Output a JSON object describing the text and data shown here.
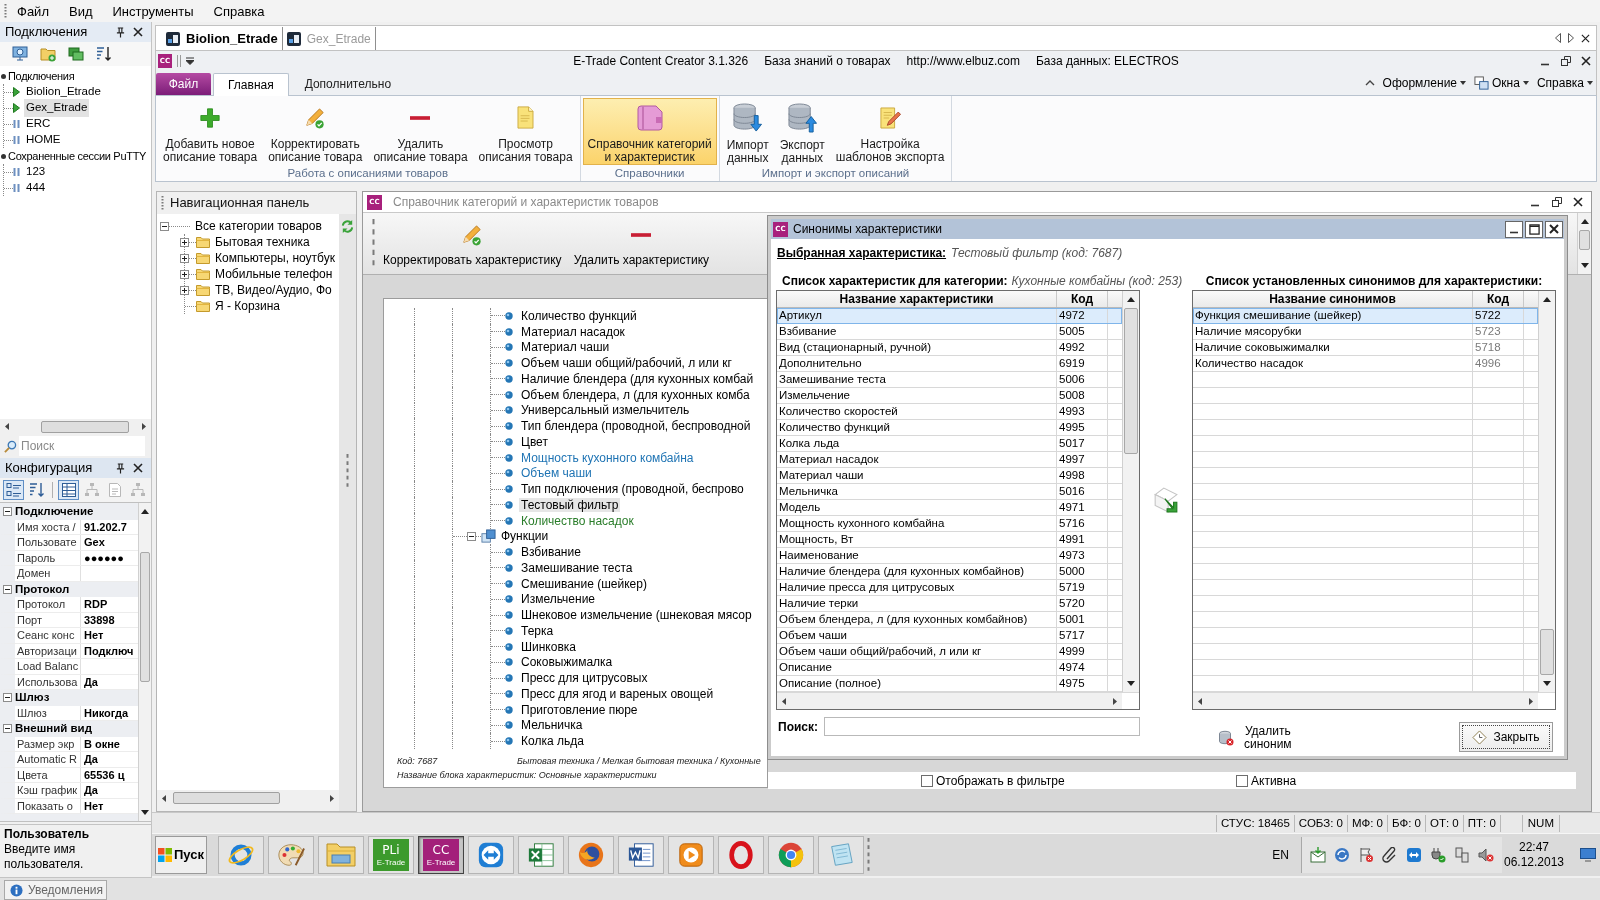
{
  "menu_bar": [
    "Файл",
    "Вид",
    "Инструменты",
    "Справка"
  ],
  "connections_panel": {
    "title": "Подключения",
    "tree": [
      {
        "label": "Подключения",
        "kind": "group",
        "children": [
          {
            "label": "Biolion_Etrade",
            "kind": "connected",
            "selected": false
          },
          {
            "label": "Gex_Etrade",
            "kind": "connected",
            "selected": true
          },
          {
            "label": "ERC",
            "kind": "saved",
            "selected": false
          },
          {
            "label": "HOME",
            "kind": "saved",
            "selected": false
          }
        ]
      },
      {
        "label": "Сохраненные сессии PuTTY",
        "kind": "group",
        "children": [
          {
            "label": "123",
            "kind": "saved",
            "selected": false
          },
          {
            "label": "444",
            "kind": "saved",
            "selected": false
          }
        ]
      }
    ],
    "search": {
      "placeholder": "Поиск"
    }
  },
  "configuration_panel": {
    "title": "Конфигурация",
    "toolbar": [
      {
        "kind": "categorized",
        "selected": true,
        "disabled": false
      },
      {
        "kind": "alphabetical",
        "selected": false,
        "disabled": false
      },
      {
        "kind": "properties",
        "selected": true,
        "disabled": false
      },
      {
        "kind": "hierarchy",
        "selected": false,
        "disabled": true
      },
      {
        "kind": "page",
        "selected": false,
        "disabled": true
      },
      {
        "kind": "hierarchy",
        "selected": false,
        "disabled": true
      }
    ],
    "categories": [
      {
        "name": "Подключение",
        "expanded": true,
        "rows": [
          {
            "label": "Имя хоста /",
            "value": "91.202.7"
          },
          {
            "label": "Пользовате",
            "value": "Gex"
          },
          {
            "label": "Пароль",
            "value": "●●●●●●"
          },
          {
            "label": "Домен"
          }
        ]
      },
      {
        "name": "Протокол",
        "expanded": true,
        "rows": [
          {
            "label": "Протокол",
            "value": "RDP"
          },
          {
            "label": "Порт",
            "value": "33898"
          },
          {
            "label": "Сеанс конс",
            "value": "Нет"
          },
          {
            "label": "Авторизаци",
            "value": "Подключ"
          },
          {
            "label": "Load Balanc"
          },
          {
            "label": "Использова",
            "value": "Да"
          }
        ]
      },
      {
        "name": "Шлюз",
        "expanded": true,
        "rows": [
          {
            "label": "Шлюз",
            "value": "Никогда"
          }
        ]
      },
      {
        "name": "Внешний вид",
        "expanded": true,
        "rows": [
          {
            "label": "Размер экр",
            "value": "В окне"
          },
          {
            "label": "Automatic R",
            "value": "Да"
          },
          {
            "label": "Цвета",
            "value": "65536 ц"
          },
          {
            "label": "Кэш график",
            "value": "Да"
          },
          {
            "label": "Показать о",
            "value": "Нет"
          }
        ]
      }
    ],
    "help": {
      "title": "Пользователь",
      "text": "Введите имя пользователя."
    }
  },
  "document_tabs": [
    {
      "label": "Biolion_Etrade",
      "selected": true
    },
    {
      "label": "Gex_Etrade",
      "selected": false
    }
  ],
  "title_bar": {
    "logo": "CC",
    "app": "E-Trade Content Creator 3.1.326",
    "links": [
      "База знаний о товарах",
      "http://www.elbuz.com"
    ],
    "database": "База данных: ELECTROS"
  },
  "ribbon": {
    "tabs": [
      {
        "label": "Файл",
        "kind": "app",
        "selected": false
      },
      {
        "label": "Главная",
        "kind": "tab",
        "selected": true
      },
      {
        "label": "Дополнительно",
        "kind": "tab",
        "selected": false
      }
    ],
    "menus": [
      {
        "label": "Оформление",
        "kind": "menu"
      },
      {
        "label": "Окна",
        "kind": "windows"
      },
      {
        "label": "Справка",
        "kind": "menu"
      }
    ],
    "groups": [
      {
        "label": "Работа с описаниями товаров",
        "buttons": [
          {
            "label": "Добавить новое\nописание товара",
            "kind": "add",
            "selected": false
          },
          {
            "label": "Корректировать\nописание товара",
            "kind": "edit",
            "selected": false
          },
          {
            "label": "Удалить\nописание товара",
            "kind": "delete",
            "selected": false
          },
          {
            "label": "Просмотр\nописания товара",
            "kind": "view",
            "selected": false
          }
        ]
      },
      {
        "label": "Справочники",
        "buttons": [
          {
            "label": "Справочник категорий\nи характеристик",
            "kind": "catalog",
            "selected": true
          }
        ]
      },
      {
        "label": "Импорт и экспорт описаний",
        "buttons": [
          {
            "label": "Импорт\nданных",
            "kind": "import",
            "selected": false
          },
          {
            "label": "Экспорт\nданных",
            "kind": "export",
            "selected": false
          },
          {
            "label": "Настройка\nшаблонов экспорта",
            "kind": "templates",
            "selected": false
          }
        ]
      }
    ]
  },
  "navigation_panel": {
    "title": "Навигационная панель",
    "tree": [
      {
        "label": "Все категории товаров",
        "expanded": true,
        "children": [
          {
            "label": "Бытовая техника",
            "expanded": false
          },
          {
            "label": "Компьютеры, ноутбук",
            "expanded": false
          },
          {
            "label": "Мобильные телефон",
            "expanded": false
          },
          {
            "label": "ТВ, Видео/Аудио, Фо",
            "expanded": false
          },
          {
            "label": "Я - Корзина"
          }
        ]
      }
    ]
  },
  "document_window": {
    "logo": "CC",
    "title": "Справочник категорий и характеристик товаров",
    "toolbar": [
      {
        "label": "Корректировать характеристику",
        "kind": "edit"
      },
      {
        "label": "Удалить характеристику",
        "kind": "delete"
      }
    ],
    "tree": [
      {
        "label": "Количество функций",
        "kind": "leaf",
        "color": "#000000",
        "selected": false
      },
      {
        "label": "Материал насадок",
        "kind": "leaf",
        "color": "#000000",
        "selected": false
      },
      {
        "label": "Материал чаши",
        "kind": "leaf",
        "color": "#000000",
        "selected": false
      },
      {
        "label": "Объем чаши общий/рабочий, л или кг",
        "kind": "leaf",
        "color": "#000000",
        "selected": false
      },
      {
        "label": "Наличие блендера (для кухонных комбай",
        "kind": "leaf",
        "color": "#000000",
        "selected": false
      },
      {
        "label": "Объем блендера, л (для кухонных комба",
        "kind": "leaf",
        "color": "#000000",
        "selected": false
      },
      {
        "label": "Универсальный измельчитель",
        "kind": "leaf",
        "color": "#000000",
        "selected": false
      },
      {
        "label": "Тип блендера (проводной, беспроводной",
        "kind": "leaf",
        "color": "#000000",
        "selected": false
      },
      {
        "label": "Цвет",
        "kind": "leaf",
        "color": "#000000",
        "selected": false
      },
      {
        "label": "Мощность кухонного комбайна",
        "kind": "leaf",
        "color": "#1f74b4",
        "selected": false
      },
      {
        "label": "Объем чаши",
        "kind": "leaf",
        "color": "#1f74b4",
        "selected": false
      },
      {
        "label": "Тип подключения (проводной, беспрово",
        "kind": "leaf",
        "color": "#000000",
        "selected": false
      },
      {
        "label": "Тестовый фильтр",
        "kind": "leaf",
        "color": "#000000",
        "selected": true
      },
      {
        "label": "Количество насадок",
        "kind": "leaf",
        "color": "#2a7d2a",
        "selected": false
      },
      {
        "label": "Функции",
        "kind": "group",
        "color": "#000000",
        "selected": false,
        "expanded": true,
        "children": [
          {
            "label": "Взбивание",
            "kind": "leaf",
            "color": "#000000",
            "selected": false
          },
          {
            "label": "Замешивание теста",
            "kind": "leaf",
            "color": "#000000",
            "selected": false
          },
          {
            "label": "Смешивание (шейкер)",
            "kind": "leaf",
            "color": "#000000",
            "selected": false
          },
          {
            "label": "Измельчение",
            "kind": "leaf",
            "color": "#000000",
            "selected": false
          },
          {
            "label": "Шнековое измельчение (шнековая мясор",
            "kind": "leaf",
            "color": "#000000",
            "selected": false
          },
          {
            "label": "Терка",
            "kind": "leaf",
            "color": "#000000",
            "selected": false
          },
          {
            "label": "Шинковка",
            "kind": "leaf",
            "color": "#000000",
            "selected": false
          },
          {
            "label": "Соковыжималка",
            "kind": "leaf",
            "color": "#000000",
            "selected": false
          },
          {
            "label": "Пресс для цитрусовых",
            "kind": "leaf",
            "color": "#000000",
            "selected": false
          },
          {
            "label": "Пресс для ягод и вареных овощей",
            "kind": "leaf",
            "color": "#000000",
            "selected": false
          },
          {
            "label": "Приготовление пюре",
            "kind": "leaf",
            "color": "#000000",
            "selected": false
          },
          {
            "label": "Мельничка",
            "kind": "leaf",
            "color": "#000000",
            "selected": false
          },
          {
            "label": "Колка льда",
            "kind": "leaf",
            "color": "#000000",
            "selected": false
          }
        ]
      }
    ],
    "footer": {
      "code": "Код: 7687",
      "path": "Бытовая техника / Мелкая бытовая техника / Кухонные",
      "block": "Название блока характеристик: Основные характеристики"
    },
    "checkboxes": [
      {
        "label": "Отображать в фильтре",
        "checked": false
      },
      {
        "label": "Активна",
        "checked": false
      }
    ]
  },
  "synonyms_dialog": {
    "logo": "CC",
    "title": "Синонимы характеристики",
    "selected_label": "Выбранная характеристика:",
    "selected_value": "Тестовый фильтр (код: 7687)",
    "left_caption": "Список характеристик для категории:",
    "left_caption_value": "Кухонные комбайны (код: 253)",
    "right_caption": "Список установленных синонимов для характеристики:",
    "characteristics_table": {
      "columns": [
        "Название характеристики",
        "Код"
      ],
      "rows": [
        {
          "name": "Артикул",
          "code": "4972",
          "selected": true
        },
        {
          "name": "Взбивание",
          "code": "5005",
          "selected": false
        },
        {
          "name": "Вид (стационарный, ручной)",
          "code": "4992",
          "selected": false
        },
        {
          "name": "Дополнительно",
          "code": "6919",
          "selected": false
        },
        {
          "name": "Замешивание теста",
          "code": "5006",
          "selected": false
        },
        {
          "name": "Измельчение",
          "code": "5008",
          "selected": false
        },
        {
          "name": "Количество скоростей",
          "code": "4993",
          "selected": false
        },
        {
          "name": "Количество функций",
          "code": "4995",
          "selected": false
        },
        {
          "name": "Колка льда",
          "code": "5017",
          "selected": false
        },
        {
          "name": "Материал насадок",
          "code": "4997",
          "selected": false
        },
        {
          "name": "Материал чаши",
          "code": "4998",
          "selected": false
        },
        {
          "name": "Мельничка",
          "code": "5016",
          "selected": false
        },
        {
          "name": "Модель",
          "code": "4971",
          "selected": false
        },
        {
          "name": "Мощность кухонного комбайна",
          "code": "5716",
          "selected": false
        },
        {
          "name": "Мощность, Вт",
          "code": "4991",
          "selected": false
        },
        {
          "name": "Наименование",
          "code": "4973",
          "selected": false
        },
        {
          "name": "Наличие блендера (для кухонных комбайнов)",
          "code": "5000",
          "selected": false
        },
        {
          "name": "Наличие пресса для цитрусовых",
          "code": "5719",
          "selected": false
        },
        {
          "name": "Наличие терки",
          "code": "5720",
          "selected": false
        },
        {
          "name": "Объем блендера, л (для кухонных комбайнов)",
          "code": "5001",
          "selected": false
        },
        {
          "name": "Объем чаши",
          "code": "5717",
          "selected": false
        },
        {
          "name": "Объем чаши общий/рабочий, л или кг",
          "code": "4999",
          "selected": false
        },
        {
          "name": "Описание",
          "code": "4974",
          "selected": false
        },
        {
          "name": "Описание (полное)",
          "code": "4975",
          "selected": false
        }
      ]
    },
    "synonyms_table": {
      "columns": [
        "Название синонимов",
        "Код"
      ],
      "rows": [
        {
          "name": "Функция смешивание (шейкер)",
          "code": "5722",
          "selected": true
        },
        {
          "name": "Наличие мясорубки",
          "code": "5723",
          "selected": false
        },
        {
          "name": "Наличие соковыжималки",
          "code": "5718",
          "selected": false
        },
        {
          "name": "Количество насадок",
          "code": "4996",
          "selected": false
        }
      ]
    },
    "search_label": "Поиск:",
    "delete_button": "Удалить\nсиноним",
    "close_button": "Закрыть"
  },
  "status_bar": {
    "counters": [
      "СТУС: 18465",
      "СОБЗ: 0",
      "МФ: 0",
      "БФ: 0",
      "ОТ: 0",
      "ПТ: 0"
    ],
    "keyboard": "NUM"
  },
  "taskbar": {
    "start": "Пуск",
    "apps": [
      {
        "kind": "orbit",
        "selected": false
      },
      {
        "kind": "palette",
        "selected": false
      },
      {
        "kind": "folder",
        "selected": false
      },
      {
        "kind": "logo",
        "logo": "PLi",
        "caption": "E-Trade",
        "color": "#3c9a2c",
        "selected": false
      },
      {
        "kind": "logo",
        "logo": "CC",
        "caption": "E-Trade",
        "color": "#a3207a",
        "selected": true
      },
      {
        "kind": "remote",
        "selected": false
      },
      {
        "kind": "sheet",
        "selected": false
      },
      {
        "kind": "swirl",
        "selected": false
      },
      {
        "kind": "doc",
        "selected": false
      },
      {
        "kind": "player",
        "selected": false
      },
      {
        "kind": "ring",
        "selected": false
      },
      {
        "kind": "wheel",
        "selected": false
      },
      {
        "kind": "notepad",
        "selected": false
      }
    ],
    "language": "EN",
    "time": "22:47",
    "date": "06.12.2013"
  },
  "notifications_tab": "Уведомления"
}
